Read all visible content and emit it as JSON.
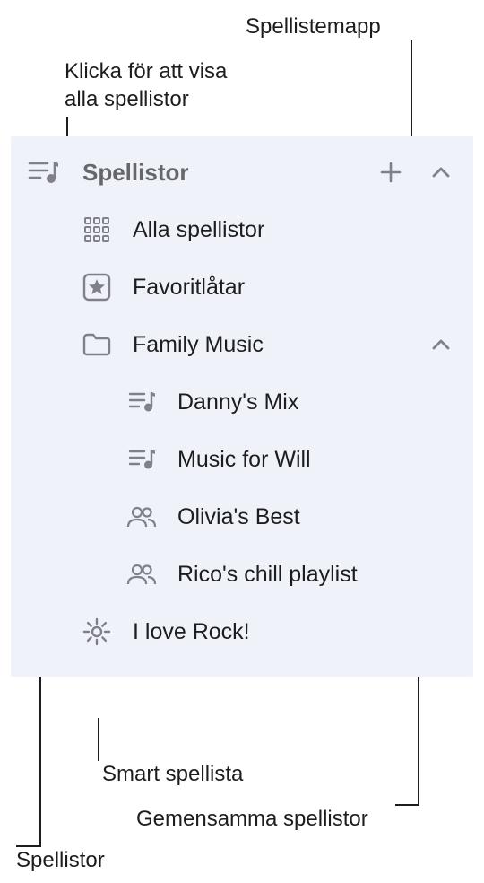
{
  "callouts": {
    "folder": "Spellistemapp",
    "click_all_line1": "Klicka för att visa",
    "click_all_line2": "alla spellistor",
    "smart": "Smart spellista",
    "shared": "Gemensamma spellistor",
    "playlists": "Spellistor"
  },
  "sidebar": {
    "header_title": "Spellistor",
    "all_playlists": "Alla spellistor",
    "favorites": "Favoritlåtar",
    "folder_name": "Family Music",
    "children": {
      "dannys_mix": "Danny's Mix",
      "music_for_will": "Music for Will",
      "olivias_best": "Olivia's Best",
      "ricos_chill": "Rico's chill playlist"
    },
    "smart_playlist": "I love Rock!"
  },
  "colors": {
    "panel_bg": "#f0f2f9",
    "icon": "#808089",
    "text": "#1d1d1f",
    "header_text": "#66676d"
  }
}
